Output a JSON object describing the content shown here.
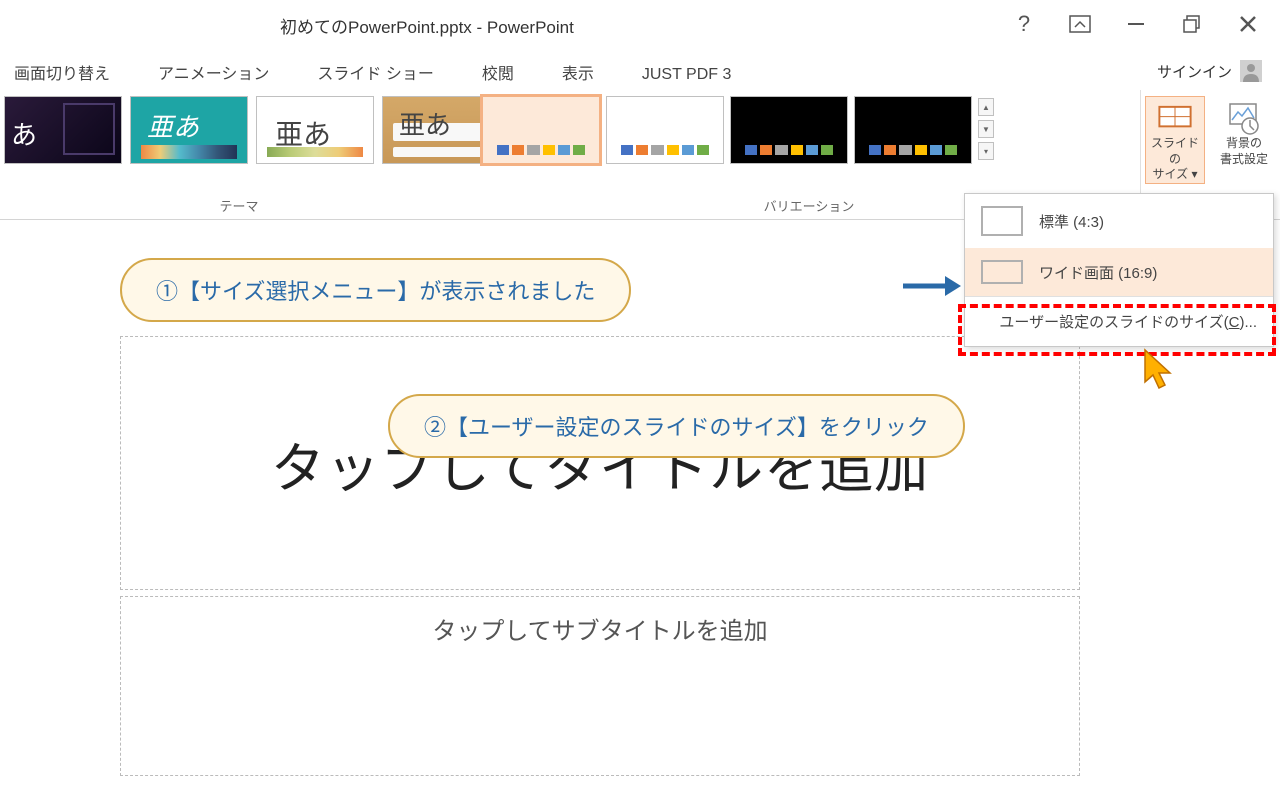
{
  "title": "初めてのPowerPoint.pptx - PowerPoint",
  "signin": "サインイン",
  "tabs": {
    "transition": "画面切り替え",
    "animation": "アニメーション",
    "slideshow": "スライド ショー",
    "review": "校閲",
    "view": "表示",
    "justpdf": "JUST PDF 3"
  },
  "groups": {
    "themes": "テーマ",
    "variations": "バリエーション"
  },
  "slideSize": {
    "label_l1": "スライドの",
    "label_l2": "サイズ ▾"
  },
  "bgFormat": {
    "label_l1": "背景の",
    "label_l2": "書式設定"
  },
  "dropdown": {
    "standard": "標準 (4:3)",
    "wide": "ワイド画面 (16:9)",
    "custom_pre": "ユーザー設定のスライドのサイズ(",
    "custom_u": "C",
    "custom_post": ")..."
  },
  "callouts": {
    "one": "①【サイズ選択メニュー】が表示されました",
    "two": "②【ユーザー設定のスライドのサイズ】をクリック"
  },
  "slide": {
    "title_ph": "タップしてタイトルを追加",
    "subtitle_ph": "タップしてサブタイトルを追加"
  }
}
